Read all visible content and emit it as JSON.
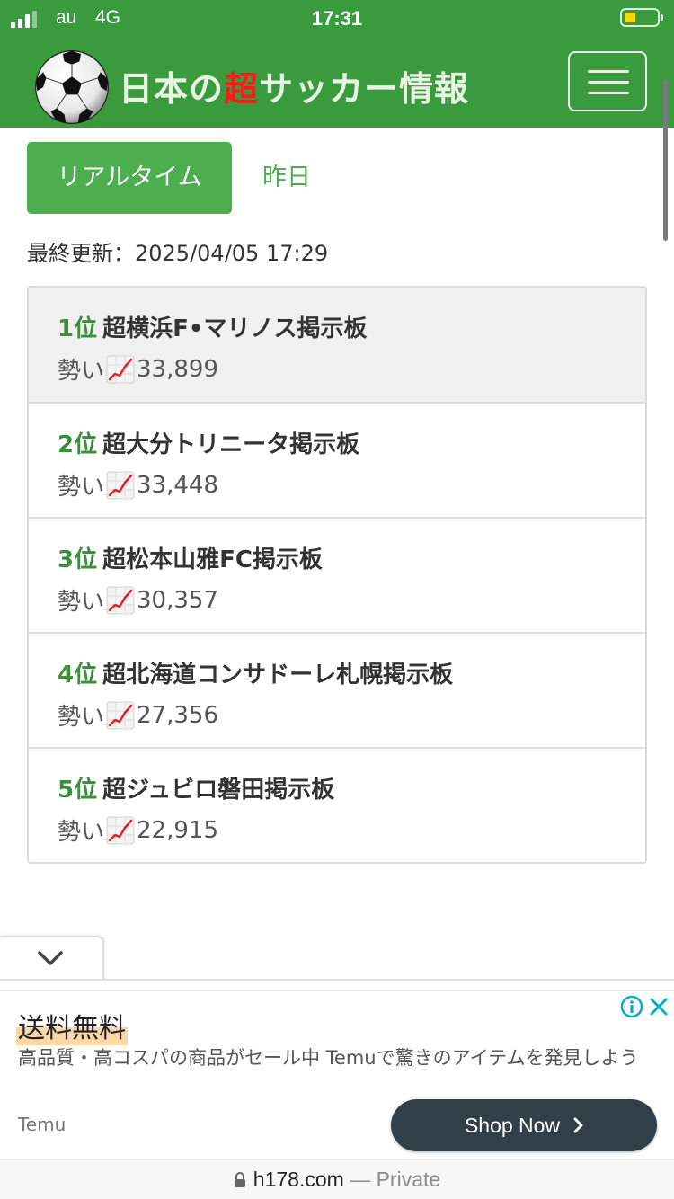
{
  "status_bar": {
    "carrier": "au",
    "network": "4G",
    "time": "17:31"
  },
  "header": {
    "title_before": "日本の",
    "title_highlight": "超",
    "title_after": "サッカー情報"
  },
  "tabs": {
    "realtime": "リアルタイム",
    "yesterday": "昨日"
  },
  "last_updated": "最終更新：2025/04/05 17:29",
  "rankings": [
    {
      "rank": "1位",
      "name": "超横浜F•マリノス掲示板",
      "momentum_label": "勢い",
      "momentum": "33,899"
    },
    {
      "rank": "2位",
      "name": "超大分トリニータ掲示板",
      "momentum_label": "勢い",
      "momentum": "33,448"
    },
    {
      "rank": "3位",
      "name": "超松本山雅FC掲示板",
      "momentum_label": "勢い",
      "momentum": "30,357"
    },
    {
      "rank": "4位",
      "name": "超北海道コンサドーレ札幌掲示板",
      "momentum_label": "勢い",
      "momentum": "27,356"
    },
    {
      "rank": "5位",
      "name": "超ジュビロ磐田掲示板",
      "momentum_label": "勢い",
      "momentum": "22,915"
    }
  ],
  "ad": {
    "headline": "送料無料",
    "body": "高品質・高コスパの商品がセール中 Temuで驚きのアイテムを発見しよう",
    "brand": "Temu",
    "cta": "Shop Now"
  },
  "url_bar": {
    "domain": "h178.com",
    "suffix": "— Private"
  },
  "colors": {
    "header_green": "#3a9a3e",
    "tab_green": "#4cae4f",
    "rank_green": "#3a8f3a",
    "title_highlight": "#ff1a1a",
    "cta_bg": "#314048"
  }
}
